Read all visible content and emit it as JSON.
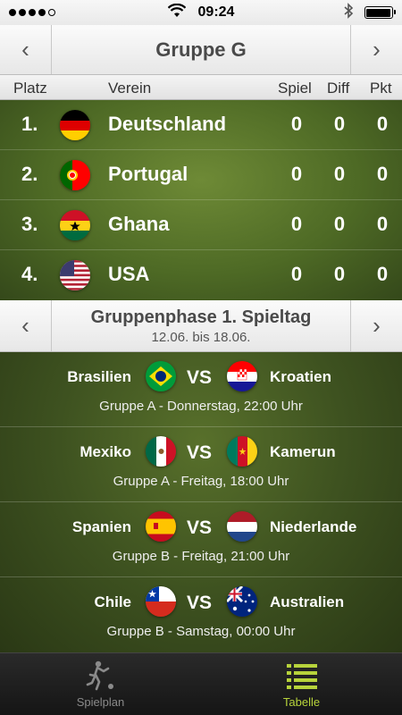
{
  "status_bar": {
    "time": "09:24",
    "signal_dots": 5,
    "signal_filled": 4,
    "icons": [
      "signal-dots-icon",
      "wifi-icon",
      "bluetooth-icon",
      "battery-icon"
    ]
  },
  "group_header": {
    "title": "Gruppe G",
    "prev_icon": "‹",
    "next_icon": "›"
  },
  "columns": {
    "place": "Platz",
    "club": "Verein",
    "played": "Spiel",
    "diff": "Diff",
    "points": "Pkt"
  },
  "standings": [
    {
      "rank": "1.",
      "team": "Deutschland",
      "flag": "germany-flag-icon",
      "played": "0",
      "diff": "0",
      "points": "0"
    },
    {
      "rank": "2.",
      "team": "Portugal",
      "flag": "portugal-flag-icon",
      "played": "0",
      "diff": "0",
      "points": "0"
    },
    {
      "rank": "3.",
      "team": "Ghana",
      "flag": "ghana-flag-icon",
      "played": "0",
      "diff": "0",
      "points": "0"
    },
    {
      "rank": "4.",
      "team": "USA",
      "flag": "usa-flag-icon",
      "played": "0",
      "diff": "0",
      "points": "0"
    }
  ],
  "matchday": {
    "title": "Gruppenphase 1. Spieltag",
    "dates": "12.06. bis 18.06.",
    "prev_icon": "‹",
    "next_icon": "›"
  },
  "matches": [
    {
      "home": "Brasilien",
      "home_flag": "brazil-flag-icon",
      "vs": "VS",
      "away": "Kroatien",
      "away_flag": "croatia-flag-icon",
      "info": "Gruppe A - Donnerstag, 22:00 Uhr"
    },
    {
      "home": "Mexiko",
      "home_flag": "mexico-flag-icon",
      "vs": "VS",
      "away": "Kamerun",
      "away_flag": "cameroon-flag-icon",
      "info": "Gruppe A - Freitag, 18:00 Uhr"
    },
    {
      "home": "Spanien",
      "home_flag": "spain-flag-icon",
      "vs": "VS",
      "away": "Niederlande",
      "away_flag": "netherlands-flag-icon",
      "info": "Gruppe B - Freitag, 21:00 Uhr"
    },
    {
      "home": "Chile",
      "home_flag": "chile-flag-icon",
      "vs": "VS",
      "away": "Australien",
      "away_flag": "australia-flag-icon",
      "info": "Gruppe B - Samstag, 00:00 Uhr"
    }
  ],
  "tabs": [
    {
      "label": "Spielplan",
      "icon": "soccer-player-icon",
      "active": false
    },
    {
      "label": "Tabelle",
      "icon": "list-icon",
      "active": true
    }
  ],
  "colors": {
    "accent": "#b7d33b",
    "header_text": "#4a4a4a",
    "tab_inactive": "#8a8a8a"
  }
}
